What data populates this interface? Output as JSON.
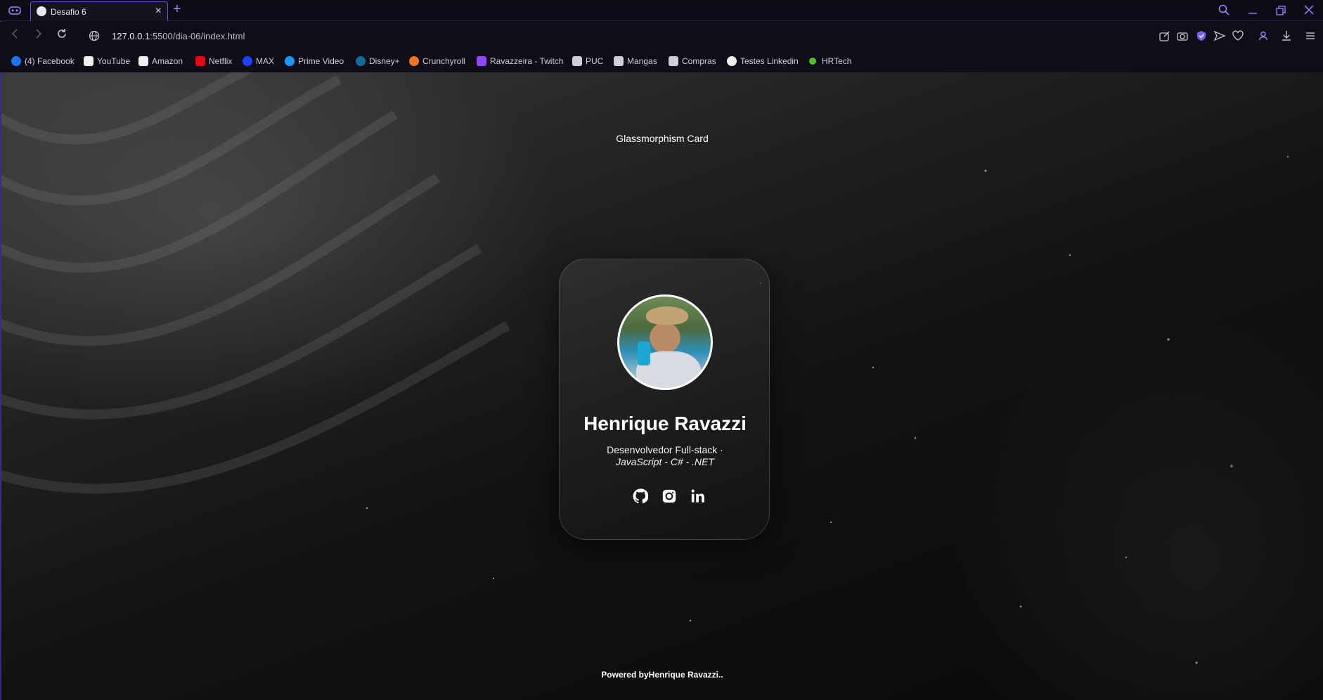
{
  "browser": {
    "tab_title": "Desafio 6",
    "url_host": "127.0.0.1",
    "url_rest": ":5500/dia-06/index.html",
    "accent_color": "#9b86ff"
  },
  "bookmarks": [
    {
      "label": "(4) Facebook",
      "icon": "facebook-icon",
      "color": "#1877f2"
    },
    {
      "label": "YouTube",
      "icon": "page-icon",
      "color": "#f0f0f0"
    },
    {
      "label": "Amazon",
      "icon": "amazon-icon",
      "color": "#f0f0f0"
    },
    {
      "label": "Netflix",
      "icon": "netflix-icon",
      "color": "#e50914"
    },
    {
      "label": "MAX",
      "icon": "max-icon",
      "color": "#2340ff"
    },
    {
      "label": "Prime Video",
      "icon": "prime-video-icon",
      "color": "#1a98ff"
    },
    {
      "label": "Disney+",
      "icon": "disney-icon",
      "color": "#0f6e9c"
    },
    {
      "label": "Crunchyroll",
      "icon": "crunchyroll-icon",
      "color": "#f47521"
    },
    {
      "label": "Ravazzeira - Twitch",
      "icon": "twitch-icon",
      "color": "#9146ff"
    },
    {
      "label": "PUC",
      "icon": "folder-icon",
      "color": "#cfcdd9"
    },
    {
      "label": "Mangas",
      "icon": "folder-icon",
      "color": "#cfcdd9"
    },
    {
      "label": "Compras",
      "icon": "folder-icon",
      "color": "#cfcdd9"
    },
    {
      "label": "Testes Linkedin",
      "icon": "github-icon",
      "color": "#f0f0f0"
    },
    {
      "label": "HRTech",
      "icon": "green-dot-icon",
      "color": "#4cc417"
    }
  ],
  "page": {
    "title": "Glassmorphism Card",
    "footer_prefix": "Powered by",
    "footer_name": "Henrique Ravazzi.."
  },
  "card": {
    "name": "Henrique Ravazzi",
    "role": "Desenvolvedor Full-stack ·",
    "stack": "JavaScript - C# - .NET",
    "socials": [
      "github-icon",
      "instagram-icon",
      "linkedin-icon"
    ]
  }
}
